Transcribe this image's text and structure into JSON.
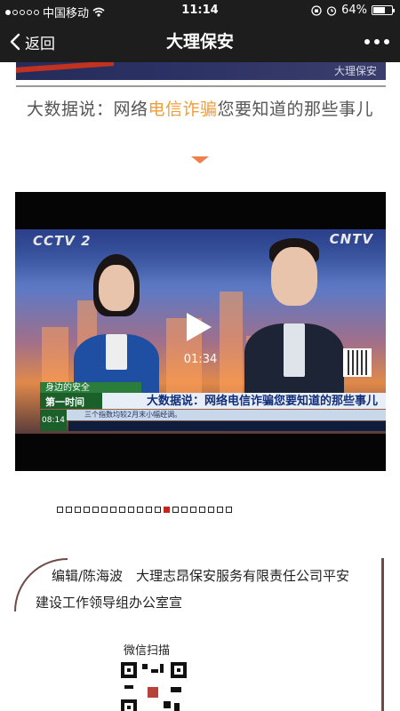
{
  "status_bar": {
    "carrier": "中国移动",
    "time": "11:14",
    "battery_percent_text": "64%",
    "battery_level": 0.64,
    "signal_dots_total": 5,
    "signal_dots_filled": 1,
    "icons": [
      "wifi-icon",
      "orientation-lock-icon",
      "alarm-icon",
      "battery-icon"
    ]
  },
  "nav": {
    "back_label": "返回",
    "title": "大理保安",
    "more_icon": "more-dots-icon"
  },
  "top_banner": {
    "brand_text": "大理保安"
  },
  "article": {
    "headline_prefix": "大数据说：网络",
    "headline_highlight": "电信诈骗",
    "headline_suffix": "您要知道的那些事儿",
    "highlight_color": "#f39c36"
  },
  "video": {
    "duration": "01:34",
    "channel_logo": "CCTV 2",
    "network_logo": "CNTV",
    "ticker_section": "身边的安全",
    "ticker_program": "第一时间",
    "ticker_headline": "大数据说：网络电信诈骗您要知道的那些事儿",
    "ticker_subline": "三个指数均较2月末小幅经调。",
    "ticker_clock": "08:14"
  },
  "pager": {
    "total": 20,
    "active_index": 12,
    "active_color": "#c0281f"
  },
  "footer": {
    "editor_line1": "编辑/陈海波　大理志昂保安服务有限责任公司平安",
    "editor_line2": "建设工作领导组办公室宣",
    "qr_label": "微信扫描"
  }
}
